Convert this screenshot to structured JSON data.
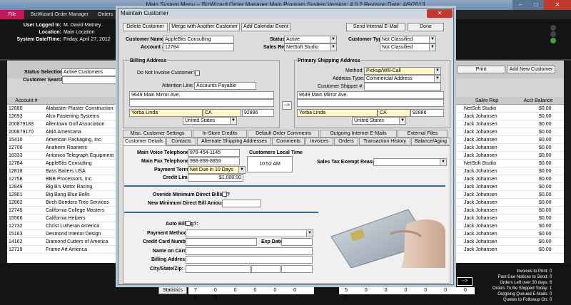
{
  "window": {
    "title": "Main System Menu -- BizWizard Order Manager Main Program System  Version: 4.0.2  Revision Date: 4/9/2013"
  },
  "menu": {
    "file": "File",
    "items": [
      "BizWizard Order Manager",
      "Orders"
    ]
  },
  "header": {
    "user_label": "User Logged In:",
    "user_value": "M. David Matney",
    "location_label": "Location:",
    "location_value": "Main Location",
    "datetime_label": "System Date/Time:",
    "datetime_value": "Friday, April 27, 2012"
  },
  "filter": {
    "status_label": "Status Selection",
    "status_value": "Active Customers",
    "search_label": "Customer Search:",
    "print_label": "Print",
    "add_label": "Add New Customer"
  },
  "grid": {
    "headers": {
      "account": "Account #",
      "sales_rep": "Sales Rep",
      "balance": "Acct Balance"
    },
    "rows": [
      {
        "acct": "12680",
        "name": "Alabaster Plaster Construction",
        "rep": "NetSoft Studio",
        "bal": "$0.00"
      },
      {
        "acct": "12693",
        "name": "Alco Fastening Systems",
        "rep": "Jack Johansen",
        "bal": "$0.00"
      },
      {
        "acct": "200879183",
        "name": "Allentown Golf Association",
        "rep": "Jack Johansen",
        "bal": "$0.00"
      },
      {
        "acct": "200879170",
        "name": "AMA Americana",
        "rep": "Jack Johansen",
        "bal": "$0.00"
      },
      {
        "acct": "15410",
        "name": "American Packaging, Inc.",
        "rep": "Jack Johansen",
        "bal": "$0.00"
      },
      {
        "acct": "12706",
        "name": "Anaheim Roamers",
        "rep": "Jack Johansen",
        "bal": "$0.00"
      },
      {
        "acct": "16333",
        "name": "Antonios Telegraph Equipment",
        "rep": "Jack Johansen",
        "bal": "$0.00"
      },
      {
        "acct": "12784",
        "name": "AppleBits Consulting",
        "rep": "NetSoft Studio",
        "bal": "$0.00"
      },
      {
        "acct": "12818",
        "name": "Bass Baiters USA",
        "rep": "Jack Johansen",
        "bal": "$0.00"
      },
      {
        "acct": "12758",
        "name": "BBB Processors, Inc.",
        "rep": "Jack Johansen",
        "bal": "$0.00"
      },
      {
        "acct": "12849",
        "name": "Big B's Motor Racing",
        "rep": "Jack Johansen",
        "bal": "$0.00"
      },
      {
        "acct": "12901",
        "name": "Big Bang Blue Bells",
        "rep": "Jack Johansen",
        "bal": "$0.00"
      },
      {
        "acct": "12862",
        "name": "Birch Benders Tree Services",
        "rep": "Jack Johansen",
        "bal": "$0.00"
      },
      {
        "acct": "12745",
        "name": "California College Masters",
        "rep": "Jack Johansen",
        "bal": "$0.00"
      },
      {
        "acct": "15566",
        "name": "California Helpers",
        "rep": "Jack Johansen",
        "bal": "$0.00"
      },
      {
        "acct": "12732",
        "name": "Christ Lutheran America",
        "rep": "Jack Johansen",
        "bal": "$0.00"
      },
      {
        "acct": "15163",
        "name": "Desmond Interior Design",
        "rep": "Jack Johansen",
        "bal": "$0.00"
      },
      {
        "acct": "14162",
        "name": "Diamond Cutters of America",
        "rep": "Jack Johansen",
        "bal": "$0.00"
      },
      {
        "acct": "12719",
        "name": "Frame Art America",
        "rep": "Jack Johansen",
        "bal": "$0.00"
      }
    ]
  },
  "stats": {
    "button": "Statistics",
    "digits_left": "7 0 0 0 0 0 0 0",
    "digits_right": "5 0 0 0 0 0 0 0 0",
    "arrow": "-->",
    "items": [
      {
        "label": "Invoices to Print:",
        "value": "0"
      },
      {
        "label": "Past Due Notices to Send:",
        "value": "0"
      },
      {
        "label": "Orders Left over 30 days:",
        "value": "6"
      },
      {
        "label": "Orders To Be Shipped Today:",
        "value": "1"
      },
      {
        "label": "Outgoing Queued E-Mails:",
        "value": "0"
      },
      {
        "label": "Quotes to Followup On:",
        "value": "0"
      }
    ]
  },
  "dialog": {
    "title": "Maintain Customer",
    "close": "✕",
    "btn_delete": "Delete Customer",
    "btn_merge": "Merge with Another Customer",
    "btn_calendar": "Add Calendar Event",
    "btn_email": "Send Internal E-Mail",
    "btn_done": "Done",
    "customer_name_label": "Customer Name:",
    "customer_name": "AppleBits Consulting",
    "account_label": "Account #:",
    "account": "12784",
    "status_label": "Status:",
    "status": "Active",
    "sales_rep_label": "Sales Rep:",
    "sales_rep": "NetSoft Studio",
    "customer_types_label": "Customer Types:",
    "type1": "Not Classified",
    "type2": "Not Classified",
    "billing_title": "Billing Address",
    "no_invoice_label": "Do Not Invoice Customer?",
    "attention_label": "Attention Line:",
    "attention": "Accounts Payable",
    "bill_addr": "9649 Main Mirror Ave.",
    "bill_city": "Yorba Linda",
    "bill_state": "CA",
    "bill_zip": "92886",
    "bill_country": "United States",
    "copy_arrow": "-->",
    "shipping_title": "Primary Shipping Address",
    "method_label": "Method:",
    "method": "Pickup/Will-Call",
    "addr_type_label": "Address Type:",
    "addr_type": "Commercial Address",
    "shipper_label": "Customer Shipper #:",
    "ship_addr": "9649 Main Mirror Ave.",
    "ship_city": "Yorba Linda",
    "ship_state": "CA",
    "ship_zip": "92886",
    "ship_country": "United States",
    "tabs_row1": [
      "Misc. Customer Settings",
      "In-Store Credits",
      "Default Order Comments",
      "Outgoing Internet E-Mails",
      "External Files"
    ],
    "tabs_row2": [
      "Customer Details",
      "Contacts",
      "Alternate Shipping Addresses",
      "Comments",
      "Invoices",
      "Orders",
      "Transaction History",
      "Balance/Aging"
    ],
    "main_phone_label": "Main Voice Telephone #:",
    "main_phone": "878-454-1145",
    "fax_label": "Main Fax Telephone #:",
    "fax": "998-898-8859",
    "terms_label": "Payment Terms:",
    "terms": "Net Due in 10 Days",
    "credit_label": "Credit Limit:",
    "credit": "$1,000.00",
    "local_time_label": "Customers Local Time",
    "local_time": "10:52 AM",
    "tax_exempt_label": "Sales Tax Exempt Reason:",
    "override_label": "Overide Minimum Direct Billing?",
    "new_min_label": "New Minimum Direct Bill Amount:",
    "auto_billing_label": "Auto Billing?:",
    "payment_method_label": "Payment Method:",
    "cc_label": "Credit Card Number:",
    "exp_label": "Exp Date:",
    "name_card_label": "Name on Card:",
    "billing_address_label": "Billing Address:",
    "city_label": "City/State/Zip:"
  }
}
